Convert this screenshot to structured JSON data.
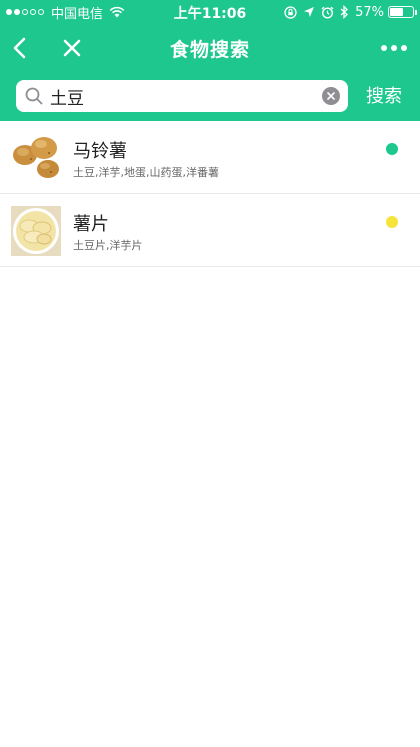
{
  "status_bar": {
    "carrier": "中国电信",
    "time": "上午11:06",
    "battery": "57%",
    "battery_level": 0.57,
    "signal_icon": "signal-dots-icon",
    "wifi_icon": "wifi-icon"
  },
  "navbar": {
    "title": "食物搜索",
    "back_icon": "back-chevron-icon",
    "close_icon": "close-icon",
    "more_icon": "more-dots-icon"
  },
  "search": {
    "value": "土豆",
    "button_label": "搜索",
    "icon": "search-icon",
    "clear_icon": "clear-icon"
  },
  "results": [
    {
      "name": "马铃薯",
      "aliases": "土豆,洋芋,地蛋,山药蛋,洋番薯",
      "status_color": "#1dc78e"
    },
    {
      "name": "薯片",
      "aliases": "土豆片,洋芋片",
      "status_color": "#f5e43a"
    }
  ],
  "colors": {
    "brand": "#1dc78e",
    "status_green": "#1dc78e",
    "status_yellow": "#f5e43a"
  }
}
